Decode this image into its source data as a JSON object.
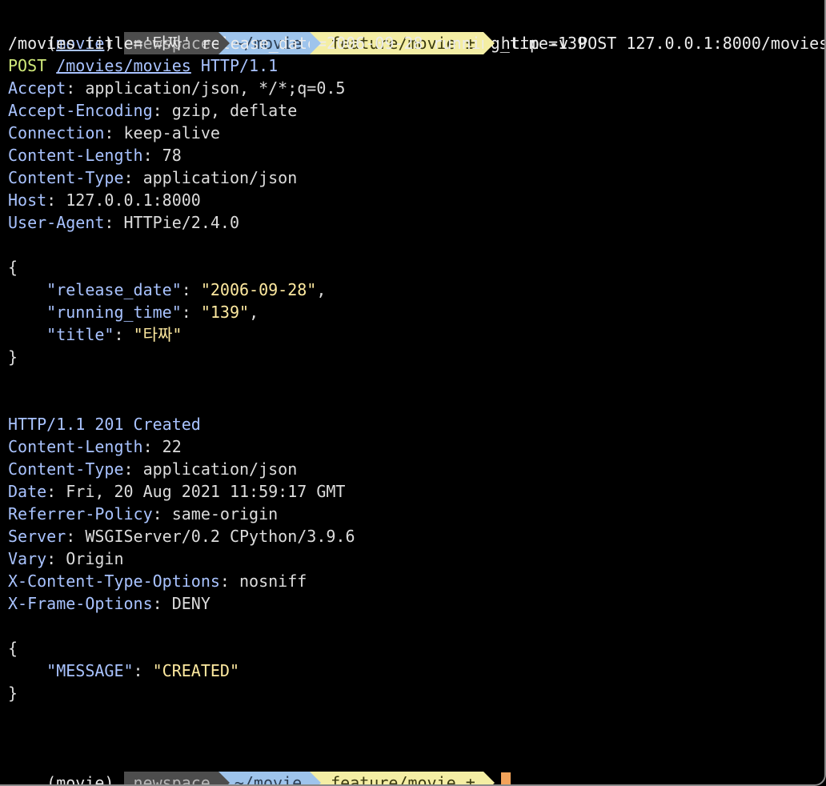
{
  "prompt1": {
    "venv_open": "(",
    "venv_name": "movie",
    "venv_close": ") ",
    "host": "newspace",
    "dir": "~/movie",
    "branch_icon": "",
    "branch": "feature/movie ±",
    "command": "http -v POST 127.0.0.1:8000/movies"
  },
  "command_cont": "/movies title='타짜' release_date=2006-09-28 running_time=139",
  "request": {
    "method": "POST",
    "path": "/movies/movies",
    "version": "HTTP/1.1",
    "headers": [
      {
        "name": "Accept",
        "value": "application/json, */*;q=0.5"
      },
      {
        "name": "Accept-Encoding",
        "value": "gzip, deflate"
      },
      {
        "name": "Connection",
        "value": "keep-alive"
      },
      {
        "name": "Content-Length",
        "value": "78"
      },
      {
        "name": "Content-Type",
        "value": "application/json"
      },
      {
        "name": "Host",
        "value": "127.0.0.1:8000"
      },
      {
        "name": "User-Agent",
        "value": "HTTPie/2.4.0"
      }
    ],
    "body_open": "{",
    "body": [
      {
        "key": "\"release_date\"",
        "value": "\"2006-09-28\"",
        "sep": ","
      },
      {
        "key": "\"running_time\"",
        "value": "\"139\"",
        "sep": ","
      },
      {
        "key": "\"title\"",
        "value": "\"타짜\"",
        "sep": ""
      }
    ],
    "body_close": "}"
  },
  "response": {
    "status": "HTTP/1.1 201 Created",
    "headers": [
      {
        "name": "Content-Length",
        "value": "22"
      },
      {
        "name": "Content-Type",
        "value": "application/json"
      },
      {
        "name": "Date",
        "value": "Fri, 20 Aug 2021 11:59:17 GMT"
      },
      {
        "name": "Referrer-Policy",
        "value": "same-origin"
      },
      {
        "name": "Server",
        "value": "WSGIServer/0.2 CPython/3.9.6"
      },
      {
        "name": "Vary",
        "value": "Origin"
      },
      {
        "name": "X-Content-Type-Options",
        "value": "nosniff"
      },
      {
        "name": "X-Frame-Options",
        "value": "DENY"
      }
    ],
    "body_open": "{",
    "body": [
      {
        "key": "\"MESSAGE\"",
        "value": "\"CREATED\"",
        "sep": ""
      }
    ],
    "body_close": "}"
  },
  "prompt2": {
    "venv": "(movie) ",
    "host": "newspace",
    "dir": "~/movie",
    "branch": "feature/movie ±"
  },
  "colors": {
    "background": "#000000",
    "cursor": "#f2a35a",
    "host_segment": "#4d4d4d",
    "dir_segment": "#9ec4ec",
    "git_segment": "#f4eea4"
  }
}
